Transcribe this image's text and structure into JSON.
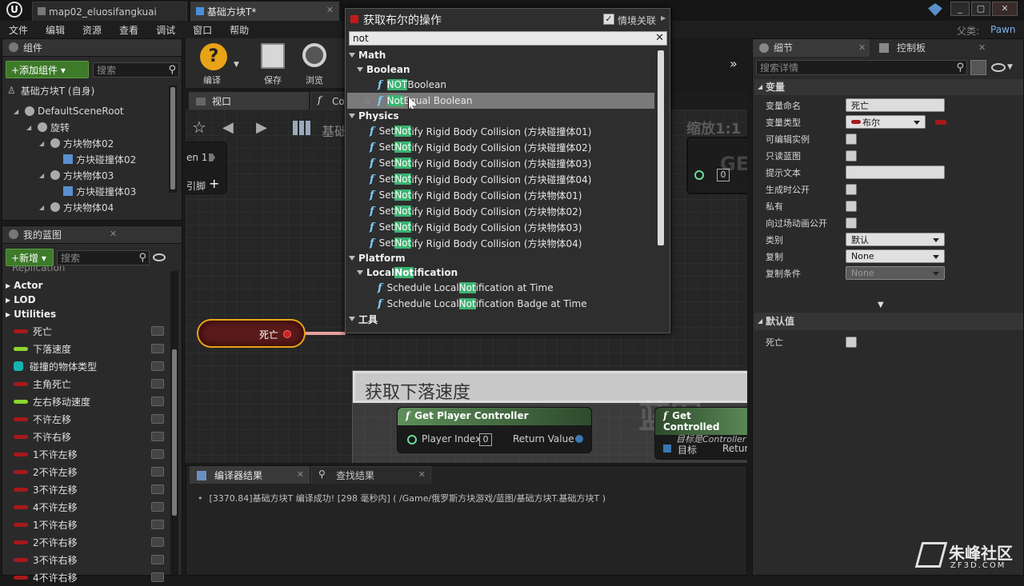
{
  "window": {
    "logo": "U",
    "tabs": [
      {
        "label": "map02_eluosifangkuai"
      },
      {
        "label": "基础方块T*"
      }
    ],
    "user": "父类:",
    "parent_class": "Pawn"
  },
  "menu": [
    "文件",
    "编辑",
    "资源",
    "查看",
    "调试",
    "窗口",
    "帮助"
  ],
  "components": {
    "tab": "组件",
    "add_button": "+添加组件 ▾",
    "search_placeholder": "搜索",
    "self_label": "基础方块T (自身)",
    "tree": [
      {
        "label": "DefaultSceneRoot",
        "indent": 0
      },
      {
        "label": "旋转",
        "indent": 1
      },
      {
        "label": "方块物体02",
        "indent": 2
      },
      {
        "label": "方块碰撞体02",
        "indent": 3
      },
      {
        "label": "方块物体03",
        "indent": 2
      },
      {
        "label": "方块碰撞体03",
        "indent": 3
      },
      {
        "label": "方块物体04",
        "indent": 2
      }
    ]
  },
  "blueprint": {
    "tab": "我的蓝图",
    "new_button": "+新增 ▾",
    "search_placeholder": "搜索",
    "faded_label": "Replication",
    "categories": [
      "Actor",
      "LOD",
      "Utilities"
    ],
    "variables": [
      {
        "label": "死亡",
        "color": "#a8181b"
      },
      {
        "label": "下落速度",
        "color": "#8cd62e"
      },
      {
        "label": "碰撞的物体类型",
        "color": "#17b3b0",
        "grid": true
      },
      {
        "label": "主角死亡",
        "color": "#a8181b"
      },
      {
        "label": "左右移动速度",
        "color": "#8cd62e"
      },
      {
        "label": "不许左移",
        "color": "#a8181b"
      },
      {
        "label": "不许右移",
        "color": "#a8181b"
      },
      {
        "label": "1不许左移",
        "color": "#a8181b"
      },
      {
        "label": "2不许左移",
        "color": "#a8181b"
      },
      {
        "label": "3不许左移",
        "color": "#a8181b"
      },
      {
        "label": "4不许左移",
        "color": "#a8181b"
      },
      {
        "label": "1不许右移",
        "color": "#a8181b"
      },
      {
        "label": "2不许右移",
        "color": "#a8181b"
      },
      {
        "label": "3不许右移",
        "color": "#a8181b"
      },
      {
        "label": "4不许右移",
        "color": "#a8181b"
      }
    ]
  },
  "toolbar": {
    "compile": "编译",
    "save": "保存",
    "browse": "浏览"
  },
  "viewport_tabs": [
    "视口",
    "Co"
  ],
  "graph": {
    "breadcrumb": "基础",
    "zoom": "缩放1:1",
    "node_label_partial": "en 1",
    "pin_label_partial": "引脚",
    "get_node_title": "GET",
    "get_node_pin": "0",
    "var_node": "死亡",
    "comment_title": "获取下落速度",
    "gpc_title": "Get Player Controller",
    "gpc_pin_in": "Player Index",
    "gpc_pin_in_val": "0",
    "gpc_pin_out": "Return Value",
    "gc_title": "Get Controlled",
    "gc_subtitle": "目标是Controller",
    "gc_pin_in": "目标",
    "gc_pin_out": "Return",
    "watermark": "蓝图"
  },
  "popup": {
    "title": "获取布尔的操作",
    "context_label": "情境关联",
    "search_value": "not",
    "groups": [
      {
        "type": "cat",
        "label": "Math",
        "level": 0
      },
      {
        "type": "cat",
        "label": "Boolean",
        "level": 1
      },
      {
        "type": "fn",
        "pre": "",
        "hl": "NOT",
        "post": " Boolean",
        "level": 2
      },
      {
        "type": "fn",
        "pre": "",
        "hl": "Not",
        "post": " Equal Boolean",
        "level": 2,
        "selected": true
      },
      {
        "type": "cat",
        "label": "Physics",
        "level": 0
      },
      {
        "type": "fn",
        "pre": "Set ",
        "hl": "Not",
        "post": "ify Rigid Body Collision (方块碰撞体01)",
        "level": 1
      },
      {
        "type": "fn",
        "pre": "Set ",
        "hl": "Not",
        "post": "ify Rigid Body Collision (方块碰撞体02)",
        "level": 1
      },
      {
        "type": "fn",
        "pre": "Set ",
        "hl": "Not",
        "post": "ify Rigid Body Collision (方块碰撞体03)",
        "level": 1
      },
      {
        "type": "fn",
        "pre": "Set ",
        "hl": "Not",
        "post": "ify Rigid Body Collision (方块碰撞体04)",
        "level": 1
      },
      {
        "type": "fn",
        "pre": "Set ",
        "hl": "Not",
        "post": "ify Rigid Body Collision (方块物体01)",
        "level": 1
      },
      {
        "type": "fn",
        "pre": "Set ",
        "hl": "Not",
        "post": "ify Rigid Body Collision (方块物体02)",
        "level": 1
      },
      {
        "type": "fn",
        "pre": "Set ",
        "hl": "Not",
        "post": "ify Rigid Body Collision (方块物体03)",
        "level": 1
      },
      {
        "type": "fn",
        "pre": "Set ",
        "hl": "Not",
        "post": "ify Rigid Body Collision (方块物体04)",
        "level": 1
      },
      {
        "type": "cat",
        "label": "Platform",
        "level": 0
      },
      {
        "type": "cat",
        "label": "Local Notification",
        "level": 1,
        "hlmid": [
          "Local ",
          "Not",
          "ification"
        ]
      },
      {
        "type": "fn",
        "pre": "Schedule Local ",
        "hl": "Not",
        "post": "ification at Time",
        "level": 2
      },
      {
        "type": "fn",
        "pre": "Schedule Local ",
        "hl": "Not",
        "post": "ification Badge at Time",
        "level": 2
      },
      {
        "type": "cat",
        "label": "工具",
        "level": 0
      }
    ]
  },
  "details": {
    "tab_details": "细节",
    "tab_control": "控制板",
    "search_placeholder": "搜索详情",
    "section_var": "变量",
    "rows": [
      {
        "label": "变量命名",
        "kind": "text",
        "value": "死亡"
      },
      {
        "label": "变量类型",
        "kind": "type",
        "value": "布尔"
      },
      {
        "label": "可编辑实例",
        "kind": "check"
      },
      {
        "label": "只读蓝图",
        "kind": "check"
      },
      {
        "label": "提示文本",
        "kind": "text",
        "value": ""
      },
      {
        "label": "生成时公开",
        "kind": "check"
      },
      {
        "label": "私有",
        "kind": "check"
      },
      {
        "label": "向过场动画公开",
        "kind": "check"
      },
      {
        "label": "类别",
        "kind": "dd",
        "value": "默认"
      },
      {
        "label": "复制",
        "kind": "dd",
        "value": "None"
      },
      {
        "label": "复制条件",
        "kind": "dd",
        "value": "None",
        "dim": true
      }
    ],
    "section_default": "默认值",
    "default_row": "死亡"
  },
  "bottom": {
    "tab_compiler": "编译器结果",
    "tab_find": "查找结果",
    "log": "[3370.84]基础方块T 编译成功! [298 毫秒内] ( /Game/俄罗斯方块游戏/蓝图/基础方块T.基础方块T )"
  },
  "watermark": {
    "brand": "朱峰社区",
    "url": "ZF3D.COM"
  }
}
